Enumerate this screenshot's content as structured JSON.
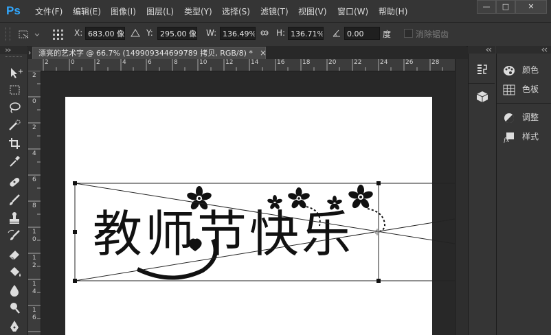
{
  "app": {
    "logo": "Ps"
  },
  "menu": [
    "文件(F)",
    "编辑(E)",
    "图像(I)",
    "图层(L)",
    "类型(Y)",
    "选择(S)",
    "滤镜(T)",
    "视图(V)",
    "窗口(W)",
    "帮助(H)"
  ],
  "window_controls": {
    "minimize": "—",
    "restore": "□",
    "close": "✕"
  },
  "options": {
    "x_label": "X:",
    "x_value": "683.00 像",
    "y_label": "Y:",
    "y_value": "295.00 像",
    "w_label": "W:",
    "w_value": "136.49%",
    "h_label": "H:",
    "h_value": "136.71%",
    "rotate_value": "0.00",
    "rotate_unit": "度",
    "antialias_label": "消除锯齿"
  },
  "document": {
    "tab_title": "漂亮的艺术字 @ 66.7% (149909344699789 拷贝, RGB/8) *",
    "close": "×",
    "artwork_text": "教师节快乐"
  },
  "rulers": {
    "h_ticks": [
      "2",
      "0",
      "2",
      "4",
      "6",
      "8",
      "10",
      "12",
      "14",
      "16",
      "18",
      "20",
      "22",
      "24",
      "26",
      "28"
    ],
    "v_ticks": [
      "2",
      "0",
      "2",
      "4",
      "6",
      "8",
      "10",
      "12",
      "14",
      "16"
    ]
  },
  "panels": [
    {
      "label": "颜色",
      "icon": "color-palette-icon"
    },
    {
      "label": "色板",
      "icon": "swatches-grid-icon"
    },
    {
      "label": "调整",
      "icon": "adjustments-icon"
    },
    {
      "label": "样式",
      "icon": "styles-fx-icon"
    }
  ],
  "tools": [
    "move-tool",
    "marquee-tool",
    "lasso-tool",
    "quick-select-tool",
    "crop-tool",
    "eyedropper-tool",
    "healing-brush-tool",
    "brush-tool",
    "clone-stamp-tool",
    "history-brush-tool",
    "eraser-tool",
    "paint-bucket-tool",
    "blur-tool",
    "dodge-tool",
    "pen-tool"
  ]
}
